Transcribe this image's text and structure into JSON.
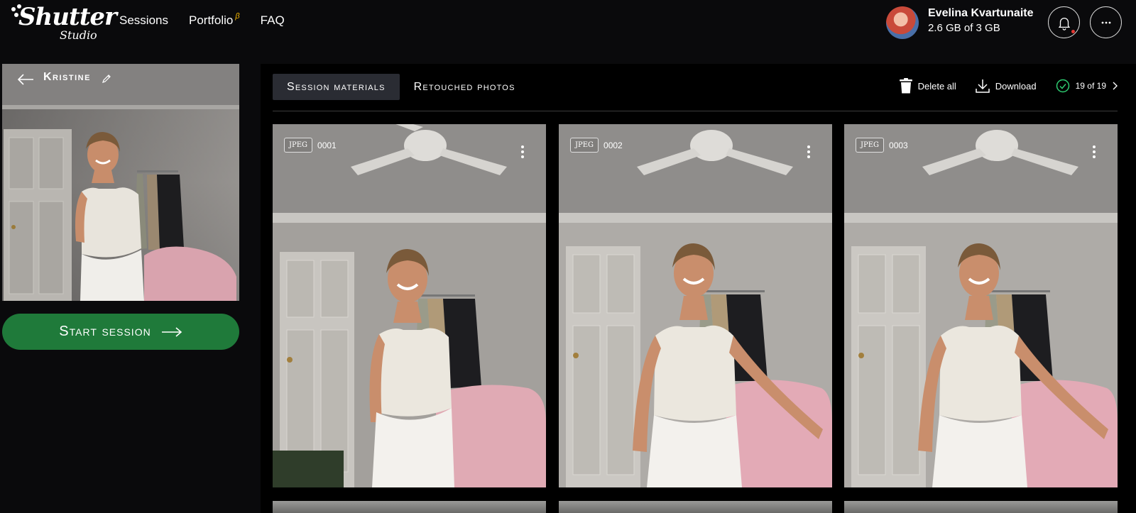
{
  "header": {
    "logo": {
      "name": "Shutter",
      "sub": "Studio"
    },
    "nav": [
      {
        "label": "Sessions"
      },
      {
        "label": "Portfolio",
        "badge": "β"
      },
      {
        "label": "FAQ"
      }
    ],
    "user": {
      "name": "Evelina Kvartunaite",
      "storage": "2.6 GB of 3 GB"
    }
  },
  "session": {
    "title": "Kristine",
    "start_label": "Start session"
  },
  "tabs": [
    {
      "label": "Session materials",
      "active": true
    },
    {
      "label": "Retouched photos",
      "active": false
    }
  ],
  "actions": {
    "delete_all": "Delete all",
    "download": "Download",
    "count": "19 of 19"
  },
  "photos": [
    {
      "format": "JPEG",
      "number": "0001"
    },
    {
      "format": "JPEG",
      "number": "0002"
    },
    {
      "format": "JPEG",
      "number": "0003"
    }
  ],
  "colors": {
    "background": "#0a0a0c",
    "panel": "#000000",
    "active_tab": "#2a2c33",
    "start_button": "#1f7a3a",
    "beta": "#f5b700",
    "check": "#2ecc71"
  },
  "icons": [
    "back-arrow-icon",
    "pencil-icon",
    "right-arrow-icon",
    "bell-icon",
    "more-icon",
    "trash-icon",
    "download-icon",
    "check-circle-icon",
    "chevron-right-icon",
    "kebab-menu-icon"
  ]
}
